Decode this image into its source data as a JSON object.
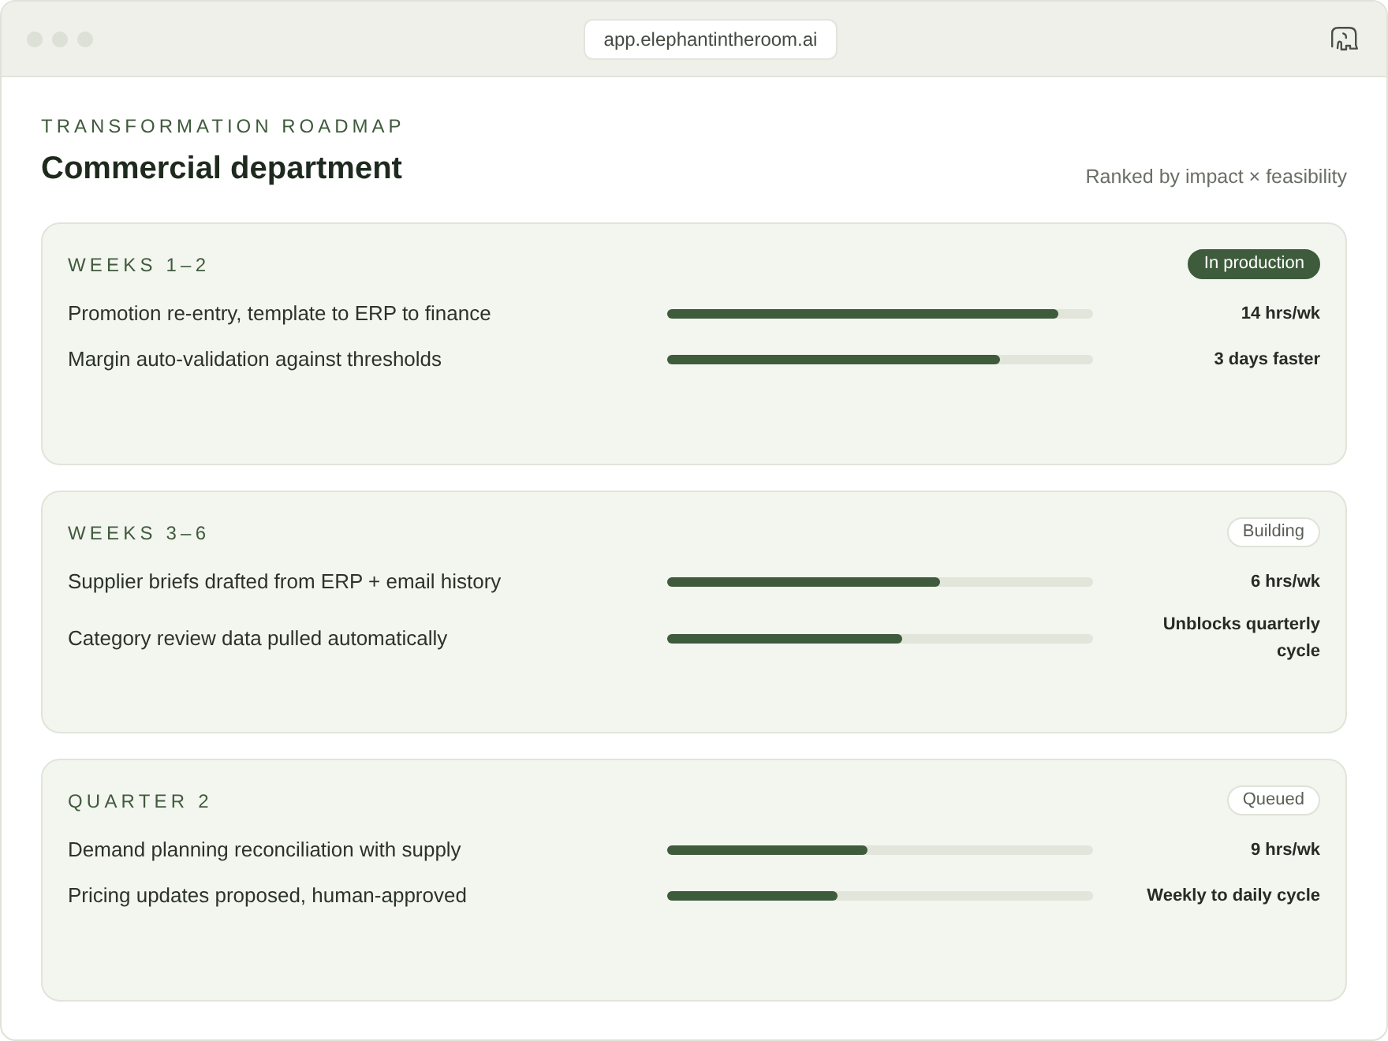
{
  "browser": {
    "url": "app.elephantintheroom.ai"
  },
  "header": {
    "eyebrow": "TRANSFORMATION ROADMAP",
    "title": "Commercial department",
    "note": "Ranked by impact × feasibility"
  },
  "phases": [
    {
      "label": "WEEKS 1–2",
      "status": {
        "label": "In production",
        "kind": "solid"
      },
      "items": [
        {
          "name": "Promotion re-entry, template to ERP to finance",
          "level": 0.92,
          "reading": "14 hrs/wk"
        },
        {
          "name": "Margin auto-validation against thresholds",
          "level": 0.78,
          "reading": "3 days faster"
        }
      ]
    },
    {
      "label": "WEEKS 3–6",
      "status": {
        "label": "Building",
        "kind": "outline"
      },
      "items": [
        {
          "name": "Supplier briefs drafted from ERP + email history",
          "level": 0.64,
          "reading": "6 hrs/wk"
        },
        {
          "name": "Category review data pulled automatically",
          "level": 0.55,
          "reading": "Unblocks quarterly cycle"
        }
      ]
    },
    {
      "label": "QUARTER 2",
      "status": {
        "label": "Queued",
        "kind": "outline"
      },
      "items": [
        {
          "name": "Demand planning reconciliation with supply",
          "level": 0.47,
          "reading": "9 hrs/wk"
        },
        {
          "name": "Pricing updates proposed, human-approved",
          "level": 0.4,
          "reading": "Weekly to daily cycle"
        }
      ]
    }
  ]
}
